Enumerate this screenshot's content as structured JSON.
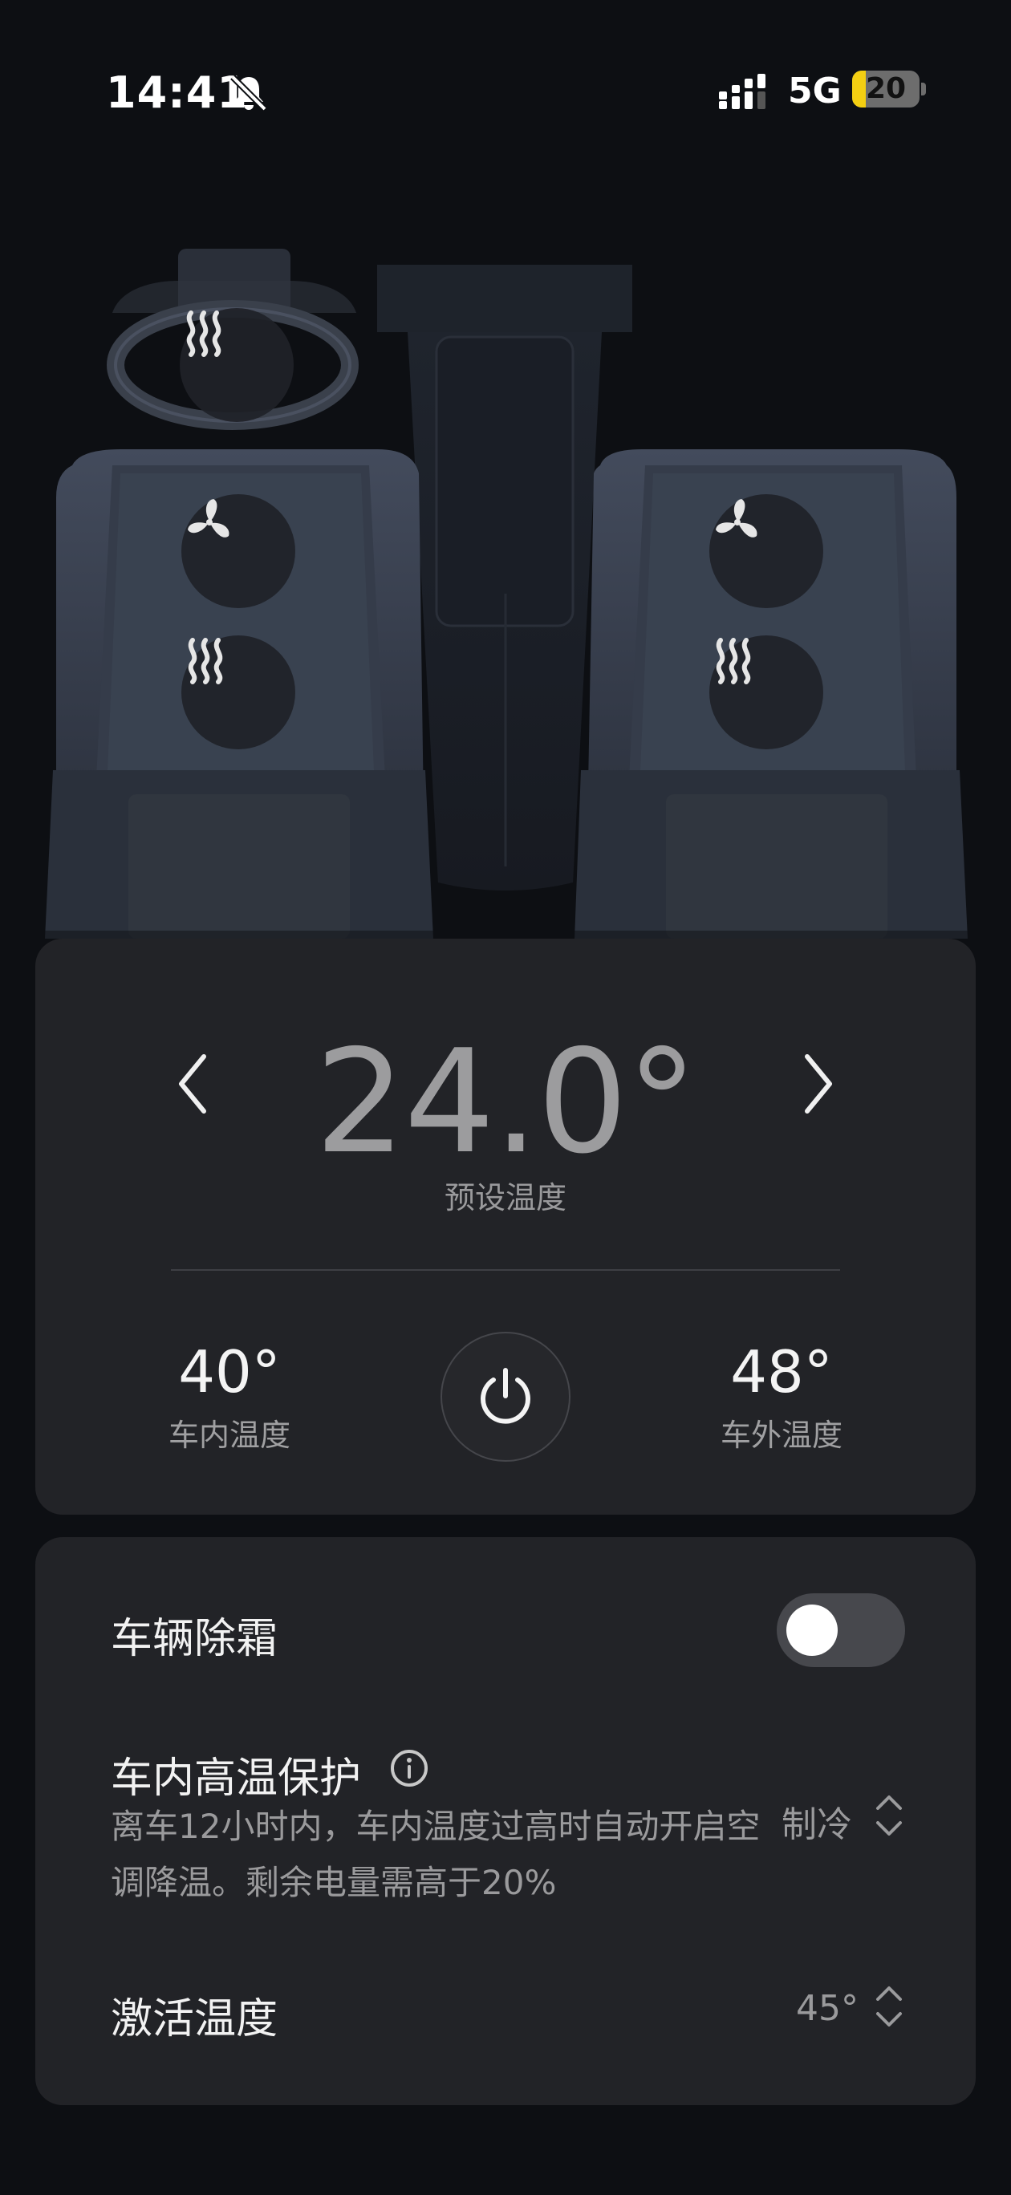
{
  "status_bar": {
    "time": "14:41",
    "network": "5G",
    "battery_level": "20",
    "battery_fraction": 0.2,
    "battery_color": "#f4cf12"
  },
  "icons": {
    "back": "arrow-left-icon",
    "steering_heat": "heat-waves-icon",
    "seat_ventilation": "fan-icon",
    "seat_heating": "heat-waves-icon",
    "prev": "chevron-left-icon",
    "next": "chevron-right-icon",
    "power": "power-icon",
    "info": "info-icon",
    "sort": "chevron-up-down-icon"
  },
  "climate": {
    "preset_temp": "24.0°",
    "preset_label": "预设温度",
    "inside_temp": "40°",
    "inside_label": "车内温度",
    "outside_temp": "48°",
    "outside_label": "车外温度"
  },
  "settings": {
    "defrost_label": "车辆除霜",
    "defrost_on": false,
    "protection_title": "车内高温保护",
    "protection_desc": "离车12小时内，车内温度过高时自动开启空调降温。剩余电量需高于20%",
    "protection_mode": "制冷",
    "activation_label": "激活温度",
    "activation_value": "45°"
  }
}
